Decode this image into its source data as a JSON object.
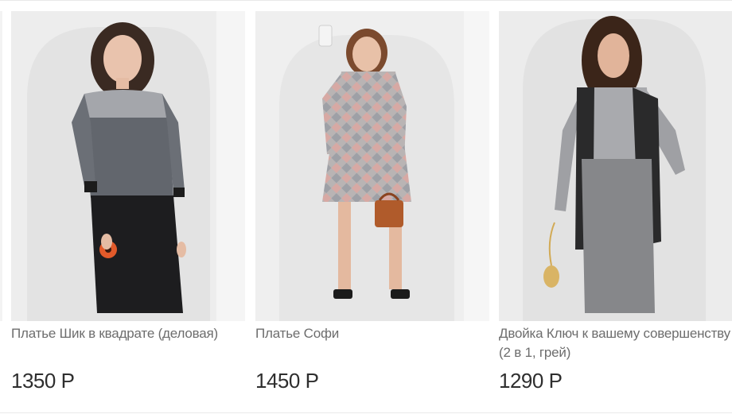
{
  "products": [
    {
      "title": "Платье Шик в квадрате (деловая)",
      "price": "1350 Р",
      "image_icon": "dress-photo-color-block"
    },
    {
      "title": "Платье Софи",
      "price": "1450 Р",
      "image_icon": "dress-photo-checked"
    },
    {
      "title": "Двойка Ключ к вашему совершенству (2 в 1, грей)",
      "price": "1290 Р",
      "image_icon": "suit-photo-grey"
    }
  ],
  "colors": {
    "title_text": "#6d6d6d",
    "price_text": "#2e2e2e",
    "photo_background": "#ececec"
  }
}
